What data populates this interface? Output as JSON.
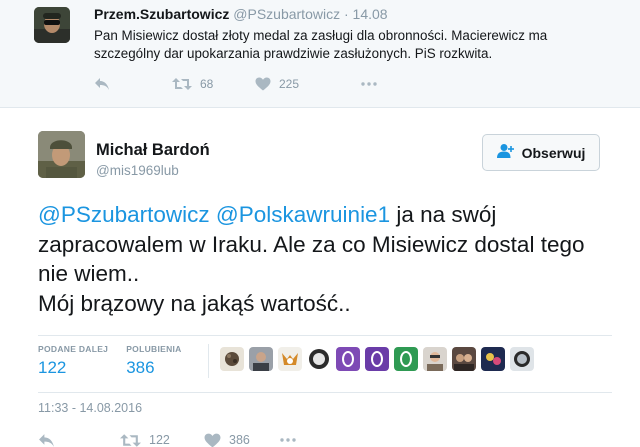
{
  "parent_tweet": {
    "name": "Przem.Szubartowicz",
    "handle": "@PSzubartowicz",
    "separator": "·",
    "date": "14.08",
    "text": "Pan Misiewicz dostał złoty medal za zasługi dla obronności. Macierewicz ma szczególny dar upokarzania prawdziwie zasłużonych. PiS rozkwita.",
    "retweets": "68",
    "likes": "225"
  },
  "main_tweet": {
    "name": "Michał Bardoń",
    "handle": "@mis1969lub",
    "follow_label": "Obserwuj",
    "mention_1": "@PSzubartowicz",
    "mention_2": "@Polskawruinie1",
    "text_part": " ja na swój zapracowalem w Iraku.  Ale za co Misiewicz dostal tego nie wiem..",
    "text_line_2": "Mój brązowy na jakąś wartość..",
    "stats": {
      "retweets_label": "PODANE DALEJ",
      "retweets": "122",
      "likes_label": "POLUBIENIA",
      "likes": "386"
    },
    "timestamp": "11:33 - 14.08.2016",
    "action_retweets": "122",
    "action_likes": "386"
  },
  "colors": {
    "link": "#1b95e0",
    "muted": "#8899a6",
    "icon": "#aab8c2",
    "border": "#e1e8ed",
    "parent_bg": "#f5f8fa"
  },
  "icons": [
    "reply-icon",
    "retweet-icon",
    "heart-icon",
    "more-icon",
    "follow-person-icon"
  ]
}
